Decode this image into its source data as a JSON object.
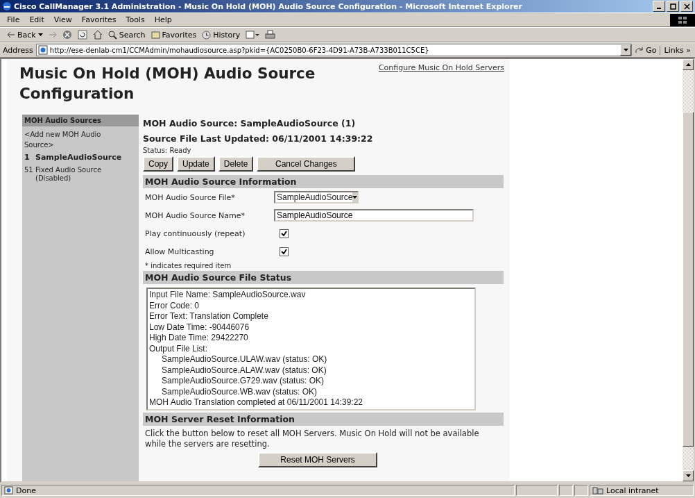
{
  "window": {
    "title": "Cisco CallManager 3.1 Administration - Music On Hold (MOH) Audio Source Configuration - Microsoft Internet Explorer"
  },
  "menu": [
    "File",
    "Edit",
    "View",
    "Favorites",
    "Tools",
    "Help"
  ],
  "toolbar": {
    "back": "Back",
    "search": "Search",
    "favorites": "Favorites",
    "history": "History"
  },
  "address": {
    "label": "Address",
    "url": "http://ese-denlab-cm1/CCMAdmin/mohaudiosource.asp?pkid={AC0250B0-6F23-4D91-A73B-A733B011C5CE}",
    "go": "Go",
    "links": "Links »"
  },
  "page": {
    "heading": "Music On Hold (MOH) Audio Source Configuration",
    "top_link": "Configure Music On Hold Servers",
    "sidebar": {
      "title": "MOH Audio Sources",
      "add": "<Add new MOH Audio Source>",
      "items": [
        {
          "number": "1",
          "label": "SampleAudioSource",
          "selected": true
        },
        {
          "number": "51",
          "label": "Fixed Audio Source (Disabled)",
          "selected": false
        }
      ]
    },
    "source_label": "MOH Audio Source:",
    "source_value": "SampleAudioSource (1)",
    "updated_label": "Source File Last Updated:",
    "updated_value": "06/11/2001 14:39:22",
    "status_label": "Status:",
    "status_value": "Ready",
    "buttons": [
      "Copy",
      "Update",
      "Delete",
      "Cancel Changes"
    ],
    "info_section": "MOH Audio Source Information",
    "fields": [
      {
        "kind": "select",
        "label": "MOH Audio Source File*",
        "value": "SampleAudioSource"
      },
      {
        "kind": "text",
        "label": "MOH Audio Source Name*",
        "value": "SampleAudioSource"
      },
      {
        "kind": "checkbox",
        "label": "Play continuously (repeat)",
        "checked": true
      },
      {
        "kind": "checkbox",
        "label": "Allow Multicasting",
        "checked": true
      }
    ],
    "required_note": "* indicates required item",
    "status_section": "MOH Audio Source File Status",
    "status_lines": [
      {
        "text": "Input File Name: SampleAudioSource.wav"
      },
      {
        "text": "Error Code: 0"
      },
      {
        "text": "Error Text: Translation Complete"
      },
      {
        "text": "Low Date Time: -90446076"
      },
      {
        "text": "High Date Time: 29422270"
      },
      {
        "text": "Output File List:",
        "children": [
          {
            "text": "SampleAudioSource.ULAW.wav (status: OK)"
          },
          {
            "text": "SampleAudioSource.ALAW.wav (status: OK)"
          },
          {
            "text": "SampleAudioSource.G729.wav (status: OK)"
          },
          {
            "text": "SampleAudioSource.WB.wav (status: OK)"
          }
        ]
      },
      {
        "text": "MOH Audio Translation completed at 06/11/2001 14:39:22"
      }
    ],
    "reset_section": "MOH Server Reset Information",
    "reset_text": "Click the button below to reset all MOH Servers. Music On Hold will not be available while the servers are resetting.",
    "reset_button": "Reset MOH Servers"
  },
  "status_bar": {
    "text": "Done",
    "zone": "Local intranet"
  }
}
